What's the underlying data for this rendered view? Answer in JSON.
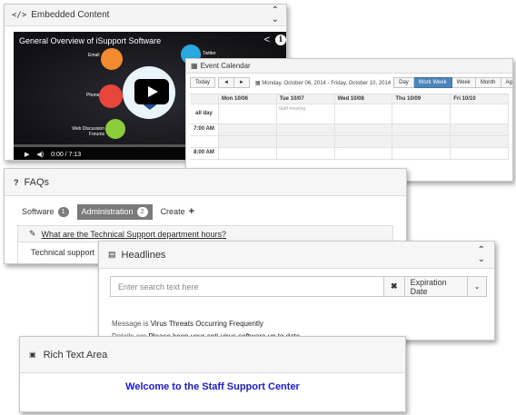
{
  "embedded": {
    "title": "Embedded Content",
    "video_title": "General Overview of iSupport Software",
    "labels": [
      "Email",
      "Twitter",
      "Phone",
      "Web Discussion Forums"
    ],
    "time": "0:00 / 7:13",
    "colors": {
      "email": "#f28b30",
      "twitter": "#2aa9e0",
      "phone": "#e8463c",
      "forums": "#8ccd3c"
    }
  },
  "calendar": {
    "title": "Event Calendar",
    "today": "Today",
    "prev": "◄",
    "next": "►",
    "range": "Monday, October 06, 2014 - Friday, October 10, 2014",
    "views": [
      "Day",
      "Work Week",
      "Week",
      "Month",
      "Agenda"
    ],
    "active_view": "Work Week",
    "days": [
      "Mon 10/06",
      "Tue 10/07",
      "Wed 10/08",
      "Thu 10/09",
      "Fri 10/10"
    ],
    "all_day_label": "all day",
    "event": "Staff meeting",
    "times": [
      "7:00 AM",
      "8:00 AM"
    ]
  },
  "faqs": {
    "title": "FAQs",
    "tabs": [
      {
        "label": "Software",
        "count": "1"
      },
      {
        "label": "Administration",
        "count": "2"
      },
      {
        "label": "Create",
        "count": "+"
      }
    ],
    "question": "What are the Technical Support department hours?",
    "answer": "Technical support"
  },
  "headlines": {
    "title": "Headlines",
    "search_placeholder": "Enter search text here",
    "clear": "✖",
    "filter": "Expiration Date",
    "dropdown": "⌄",
    "message_label": "Message is ",
    "message_value": "Virus Threats Occurring Frequently",
    "details_label": "Details are ",
    "details_value": "Please keep your anti-virus software up to date."
  },
  "richtext": {
    "title": "Rich Text Area",
    "content": "Welcome to the Staff Support Center"
  }
}
